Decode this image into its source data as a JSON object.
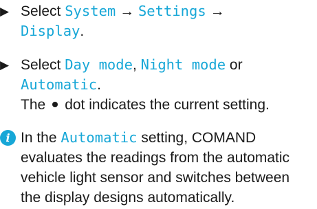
{
  "step1": {
    "bullet": "▶",
    "select": "Select",
    "system": "System",
    "arrow1": "→",
    "settings": "Settings",
    "arrow2": "→",
    "display": "Display",
    "period": "."
  },
  "step2": {
    "bullet": "▶",
    "select": "Select",
    "day_mode": "Day mode",
    "comma": ",",
    "night_mode": "Night mode",
    "or": "or",
    "automatic": "Automatic",
    "period": ".",
    "result_pre": "The",
    "result_post": "dot indicates the current setting."
  },
  "note": {
    "icon": "i",
    "intro": "In the",
    "automatic": "Automatic",
    "line1_rest": "setting, COMAND",
    "line2": "evaluates the readings from the automatic",
    "line3": "vehicle light sensor and switches between",
    "line4": "the display designs automatically."
  },
  "colors": {
    "accent": "#17a7d7",
    "text": "#1a1a1a"
  }
}
